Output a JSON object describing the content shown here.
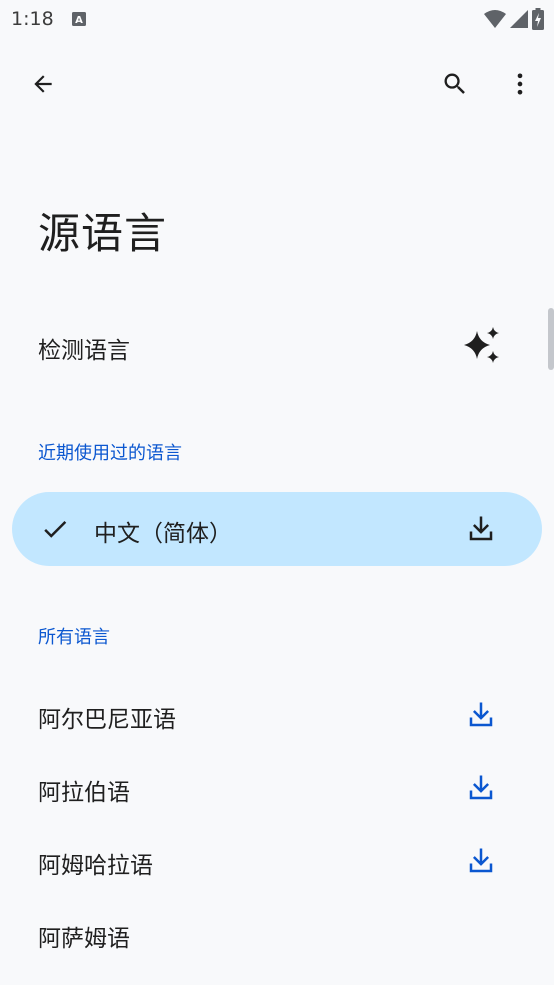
{
  "status_bar": {
    "time": "1:18",
    "notification_icon": "text-a-icon",
    "icons": [
      "wifi-icon",
      "signal-icon",
      "battery-charging-icon"
    ]
  },
  "toolbar": {
    "back_icon": "arrow-back-icon",
    "search_icon": "search-icon",
    "more_icon": "more-vert-icon"
  },
  "page": {
    "title": "源语言"
  },
  "detect": {
    "label": "检测语言",
    "icon": "sparkle-icon"
  },
  "recent": {
    "header": "近期使用过的语言",
    "items": [
      {
        "label": "中文（简体）",
        "selected": true,
        "icon": "download-icon"
      }
    ]
  },
  "all": {
    "header": "所有语言",
    "items": [
      {
        "label": "阿尔巴尼亚语",
        "icon": "download-icon"
      },
      {
        "label": "阿拉伯语",
        "icon": "download-icon"
      },
      {
        "label": "阿姆哈拉语",
        "icon": "download-icon"
      },
      {
        "label": "阿萨姆语",
        "icon": ""
      }
    ]
  },
  "colors": {
    "accent": "#0b57d0",
    "selected_bg": "#c2e7ff",
    "background": "#f8f9fb",
    "text": "#1f1f1f"
  }
}
